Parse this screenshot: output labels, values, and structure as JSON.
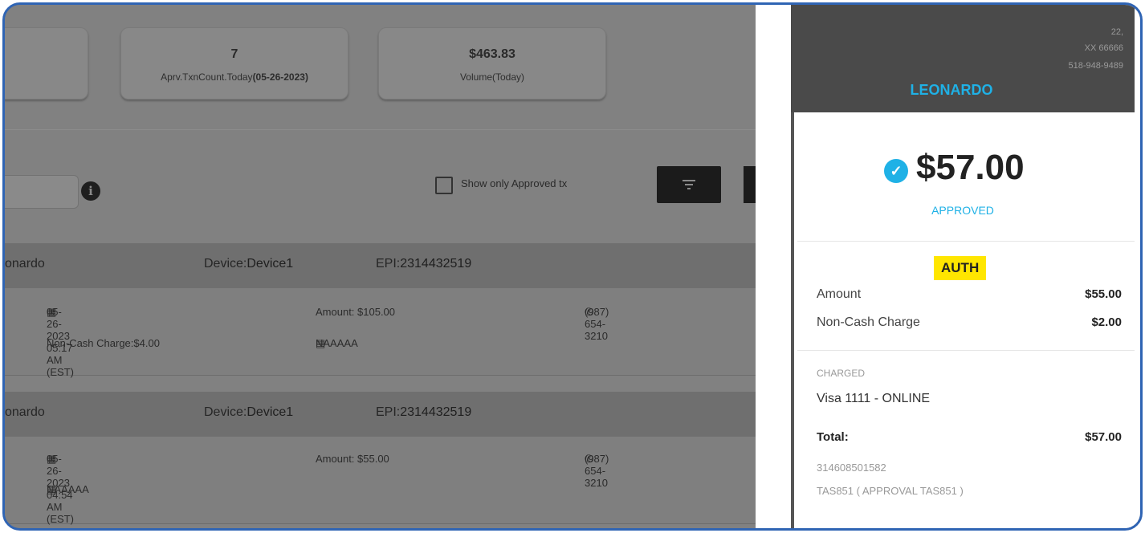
{
  "stats": [
    {
      "value": "7",
      "label": "Aprv.TxnCount.Today",
      "label_bold": "(05-26-2023)"
    },
    {
      "value": "$463.83",
      "label": "Volume(Today)"
    }
  ],
  "filters": {
    "show_approved_label": "Show only Approved tx",
    "info_glyph": "i"
  },
  "transactions": [
    {
      "merchant_partial": "onardo",
      "device_prefix": "Device:",
      "device": "Device1",
      "epi_prefix": "EPI:",
      "epi": "2314432519",
      "datetime": "05-26-2023 05:17 AM (EST)",
      "amount": "Amount: $105.00",
      "phone": "(987) 654-3210",
      "noncash": "Non-Cash Charge:$4.00",
      "card": "NAAAAA"
    },
    {
      "merchant_partial": "onardo",
      "device_prefix": "Device:",
      "device": "Device1",
      "epi_prefix": "EPI:",
      "epi": "2314432519",
      "datetime": "05-26-2023 04:54 AM (EST)",
      "amount": "Amount: $55.00",
      "phone": "(987) 654-3210",
      "card": "NAAAAA"
    }
  ],
  "receipt": {
    "address_line1": "22,",
    "address_line2": "XX 66666",
    "phone": "518-948-9489",
    "merchant_name": "LEONARDO",
    "total_amount": "$57.00",
    "status": "APPROVED",
    "type_badge": "AUTH",
    "amount_label": "Amount",
    "amount_value": "$55.00",
    "noncash_label": "Non-Cash Charge",
    "noncash_value": "$2.00",
    "charged_label": "CHARGED",
    "card": "Visa 1111 - ONLINE",
    "total_label": "Total:",
    "total_value": "$57.00",
    "reference": "314608501582",
    "approval": "TAS851 ( APPROVAL TAS851 )"
  },
  "colors": {
    "accent": "#1fb1e6",
    "badge": "#ffe600",
    "frame": "#2f64b4"
  }
}
